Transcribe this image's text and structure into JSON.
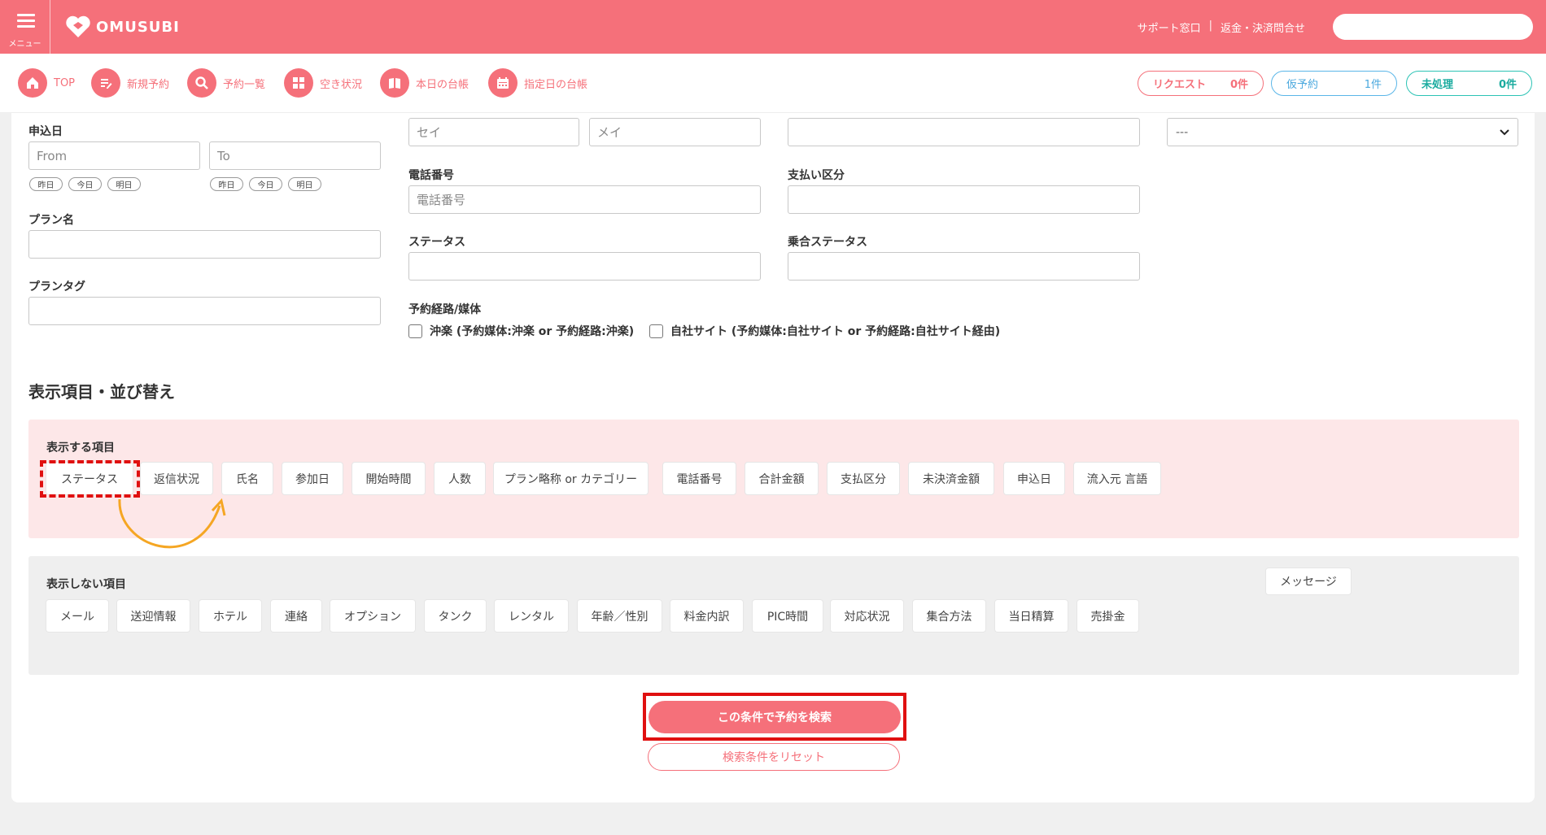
{
  "header": {
    "menu_label": "メニュー",
    "logo": "OMUSUBI",
    "support": "サポート窓口",
    "separator": "|",
    "refund": "返金・決済問合せ",
    "search_value": ""
  },
  "nav": {
    "items": [
      "TOP",
      "新規予約",
      "予約一覧",
      "空き状況",
      "本日の台帳",
      "指定日の台帳"
    ]
  },
  "counters": {
    "request_label": "リクエスト",
    "request_count": "0件",
    "temp_label": "仮予約",
    "temp_count": "1件",
    "unprocessed_label": "未処理",
    "unprocessed_count": "0件"
  },
  "form": {
    "apply_date_label": "申込日",
    "from_placeholder": "From",
    "to_placeholder": "To",
    "chips": [
      "昨日",
      "今日",
      "明日"
    ],
    "plan_name_label": "プラン名",
    "plan_tag_label": "プランタグ",
    "sei_placeholder": "セイ",
    "mei_placeholder": "メイ",
    "phone_label": "電話番号",
    "phone_placeholder": "電話番号",
    "status_label": "ステータス",
    "channel_label": "予約経路/媒体",
    "channel_opt1": "沖楽 (予約媒体:沖楽 or 予約経路:沖楽)",
    "channel_opt2": "自社サイト (予約媒体:自社サイト or 予約経路:自社サイト経由)",
    "payment_label": "支払い区分",
    "boarding_label": "乗合ステータス",
    "select_value": "---"
  },
  "display": {
    "section_title": "表示項目・並び替え",
    "shown_label": "表示する項目",
    "shown_items": [
      "ステータス",
      "返信状況",
      "氏名",
      "参加日",
      "開始時間",
      "人数",
      "プラン略称 or カテゴリー",
      "電話番号",
      "合計金額",
      "支払区分",
      "未決済金額",
      "申込日",
      "流入元 言語"
    ],
    "hidden_label": "表示しない項目",
    "hidden_items": [
      "メール",
      "送迎情報",
      "ホテル",
      "連絡",
      "オプション",
      "タンク",
      "レンタル",
      "年齢／性別",
      "料金内訳",
      "PIC時間",
      "対応状況",
      "集合方法",
      "当日精算",
      "売掛金"
    ],
    "message_item": "メッセージ"
  },
  "actions": {
    "search": "この条件で予約を検索",
    "reset": "検索条件をリセット"
  },
  "colors": {
    "brand": "#f5707a",
    "highlight": "#e01010",
    "arrow": "#f5a623",
    "temp": "#4aa8de",
    "unprocessed": "#1aab9f"
  }
}
